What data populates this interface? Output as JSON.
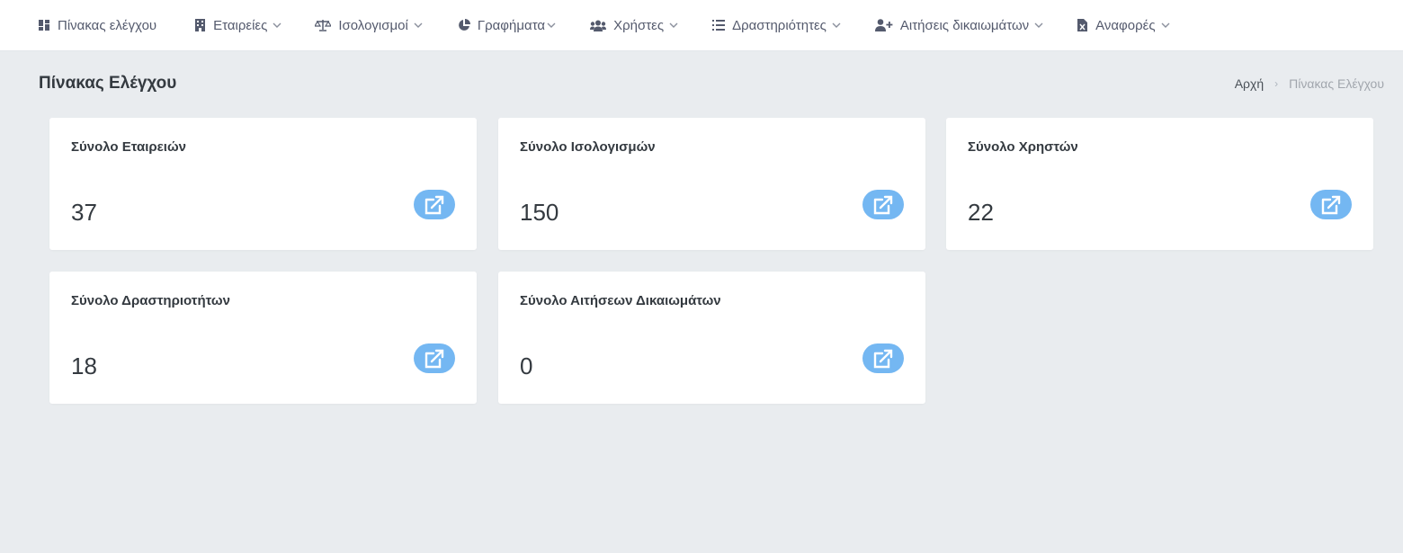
{
  "nav": {
    "items": [
      {
        "label": "Πίνακας ελέγχου",
        "icon": "dashboard-icon",
        "has_dropdown": false
      },
      {
        "label": "Εταιρείες",
        "icon": "building-icon",
        "has_dropdown": true
      },
      {
        "label": "Ισολογισμοί",
        "icon": "balance-scale-icon",
        "has_dropdown": true
      },
      {
        "label": "Γραφήματα",
        "icon": "pie-chart-icon",
        "has_dropdown": true
      },
      {
        "label": "Χρήστες",
        "icon": "users-icon",
        "has_dropdown": true
      },
      {
        "label": "Δραστηριότητες",
        "icon": "list-icon",
        "has_dropdown": true
      },
      {
        "label": "Αιτήσεις δικαιωμάτων",
        "icon": "user-plus-icon",
        "has_dropdown": true
      },
      {
        "label": "Αναφορές",
        "icon": "file-excel-icon",
        "has_dropdown": true
      }
    ]
  },
  "header": {
    "title": "Πίνακας Ελέγχου",
    "breadcrumb": {
      "home": "Αρχή",
      "current": "Πίνακας Ελέγχου"
    }
  },
  "cards": [
    {
      "title": "Σύνολο Εταιρειών",
      "value": "37"
    },
    {
      "title": "Σύνολο Ισολογισμών",
      "value": "150"
    },
    {
      "title": "Σύνολο Χρηστών",
      "value": "22"
    },
    {
      "title": "Σύνολο Δραστηριοτήτων",
      "value": "18"
    },
    {
      "title": "Σύνολο Αιτήσεων Δικαιωμάτων",
      "value": "0"
    }
  ],
  "colors": {
    "accent_button": "#74b7f2",
    "background": "#e9ecef",
    "nav_text": "#545a6d"
  }
}
